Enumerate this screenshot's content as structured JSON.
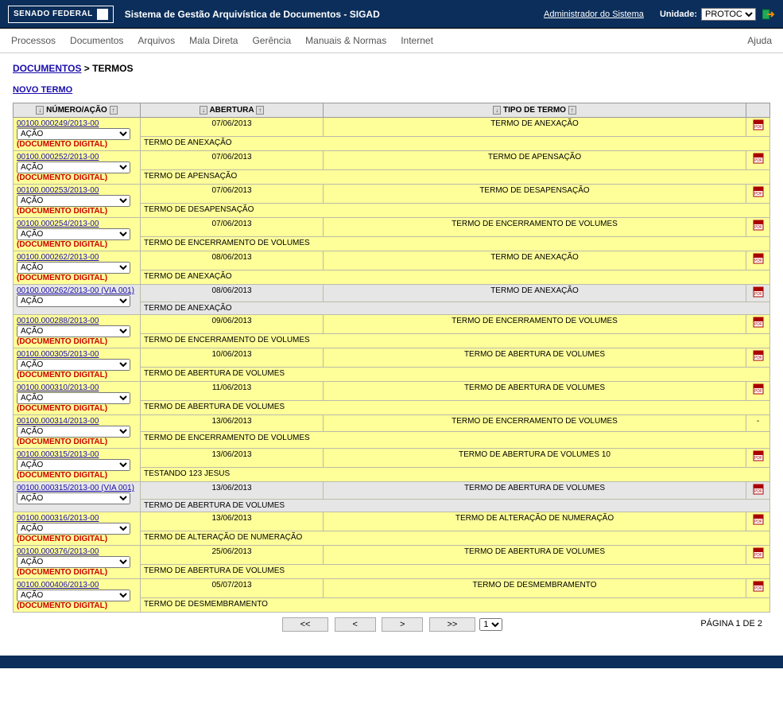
{
  "header": {
    "logo_text": "SENADO FEDERAL",
    "system_title": "Sistema de Gestão Arquivística de Documentos - SIGAD",
    "admin_link": "Administrador do Sistema",
    "unit_label": "Unidade:",
    "unit_value": "PROTOC"
  },
  "menu": {
    "items": [
      "Processos",
      "Documentos",
      "Arquivos",
      "Mala Direta",
      "Gerência",
      "Manuais & Normas",
      "Internet"
    ],
    "help": "Ajuda"
  },
  "breadcrumb": {
    "root": "DOCUMENTOS",
    "current": "TERMOS"
  },
  "actions": {
    "new_termo": "NOVO TERMO",
    "acao_default": "AÇÃO",
    "doc_digital": "(DOCUMENTO DIGITAL)"
  },
  "columns": {
    "num": "NÚMERO/AÇÃO",
    "abertura": "ABERTURA",
    "tipo": "TIPO DE TERMO"
  },
  "rows": [
    {
      "num": "00100.000249/2013-00",
      "via": false,
      "date": "07/06/2013",
      "tipo": "TERMO DE ANEXAÇÃO",
      "desc": "TERMO DE ANEXAÇÃO",
      "pdf": true,
      "digital": true,
      "alt": false
    },
    {
      "num": "00100.000252/2013-00",
      "via": false,
      "date": "07/06/2013",
      "tipo": "TERMO DE APENSAÇÃO",
      "desc": "TERMO DE APENSAÇÃO",
      "pdf": true,
      "digital": true,
      "alt": false
    },
    {
      "num": "00100.000253/2013-00",
      "via": false,
      "date": "07/06/2013",
      "tipo": "TERMO DE DESAPENSAÇÃO",
      "desc": "TERMO DE DESAPENSAÇÃO",
      "pdf": true,
      "digital": true,
      "alt": false
    },
    {
      "num": "00100.000254/2013-00",
      "via": false,
      "date": "07/06/2013",
      "tipo": "TERMO DE ENCERRAMENTO DE VOLUMES",
      "desc": "TERMO DE ENCERRAMENTO DE VOLUMES",
      "pdf": true,
      "digital": true,
      "alt": false
    },
    {
      "num": "00100.000262/2013-00",
      "via": false,
      "date": "08/06/2013",
      "tipo": "TERMO DE ANEXAÇÃO",
      "desc": "TERMO DE ANEXAÇÃO",
      "pdf": true,
      "digital": true,
      "alt": false
    },
    {
      "num": "00100.000262/2013-00 (VIA 001)",
      "via": true,
      "date": "08/06/2013",
      "tipo": "TERMO DE ANEXAÇÃO",
      "desc": "TERMO DE ANEXAÇÃO",
      "pdf": true,
      "digital": false,
      "alt": true
    },
    {
      "num": "00100.000288/2013-00",
      "via": false,
      "date": "09/06/2013",
      "tipo": "TERMO DE ENCERRAMENTO DE VOLUMES",
      "desc": "TERMO DE ENCERRAMENTO DE VOLUMES",
      "pdf": true,
      "digital": true,
      "alt": false
    },
    {
      "num": "00100.000305/2013-00",
      "via": false,
      "date": "10/06/2013",
      "tipo": "TERMO DE ABERTURA DE VOLUMES",
      "desc": "TERMO DE ABERTURA DE VOLUMES",
      "pdf": true,
      "digital": true,
      "alt": false
    },
    {
      "num": "00100.000310/2013-00",
      "via": false,
      "date": "11/06/2013",
      "tipo": "TERMO DE ABERTURA DE VOLUMES",
      "desc": "TERMO DE ABERTURA DE VOLUMES",
      "pdf": true,
      "digital": true,
      "alt": false
    },
    {
      "num": "00100.000314/2013-00",
      "via": false,
      "date": "13/06/2013",
      "tipo": "TERMO DE ENCERRAMENTO DE VOLUMES",
      "desc": "TERMO DE ENCERRAMENTO DE VOLUMES",
      "pdf": false,
      "digital": true,
      "alt": false
    },
    {
      "num": "00100.000315/2013-00",
      "via": false,
      "date": "13/06/2013",
      "tipo": "TERMO DE ABERTURA DE VOLUMES 10",
      "desc": "TESTANDO 123 JESUS",
      "pdf": true,
      "digital": true,
      "alt": false
    },
    {
      "num": "00100.000315/2013-00 (VIA 001)",
      "via": true,
      "date": "13/06/2013",
      "tipo": "TERMO DE ABERTURA DE VOLUMES",
      "desc": "TERMO DE ABERTURA DE VOLUMES",
      "pdf": true,
      "digital": false,
      "alt": true
    },
    {
      "num": "00100.000316/2013-00",
      "via": false,
      "date": "13/06/2013",
      "tipo": "TERMO DE ALTERAÇÃO DE NUMERAÇÃO",
      "desc": "TERMO DE ALTERAÇÃO DE NUMERAÇÃO",
      "pdf": true,
      "digital": true,
      "alt": false
    },
    {
      "num": "00100.000376/2013-00",
      "via": false,
      "date": "25/06/2013",
      "tipo": "TERMO DE ABERTURA DE VOLUMES",
      "desc": "TERMO DE ABERTURA DE VOLUMES",
      "pdf": true,
      "digital": true,
      "alt": false
    },
    {
      "num": "00100.000406/2013-00",
      "via": false,
      "date": "05/07/2013",
      "tipo": "TERMO DE DESMEMBRAMENTO",
      "desc": "TERMO DE DESMEMBRAMENTO",
      "pdf": true,
      "digital": true,
      "alt": false
    }
  ],
  "pager": {
    "first": "<<",
    "prev": "<",
    "next": ">",
    "last": ">>",
    "page_sel": "1",
    "info": "PÁGINA 1 DE 2"
  }
}
